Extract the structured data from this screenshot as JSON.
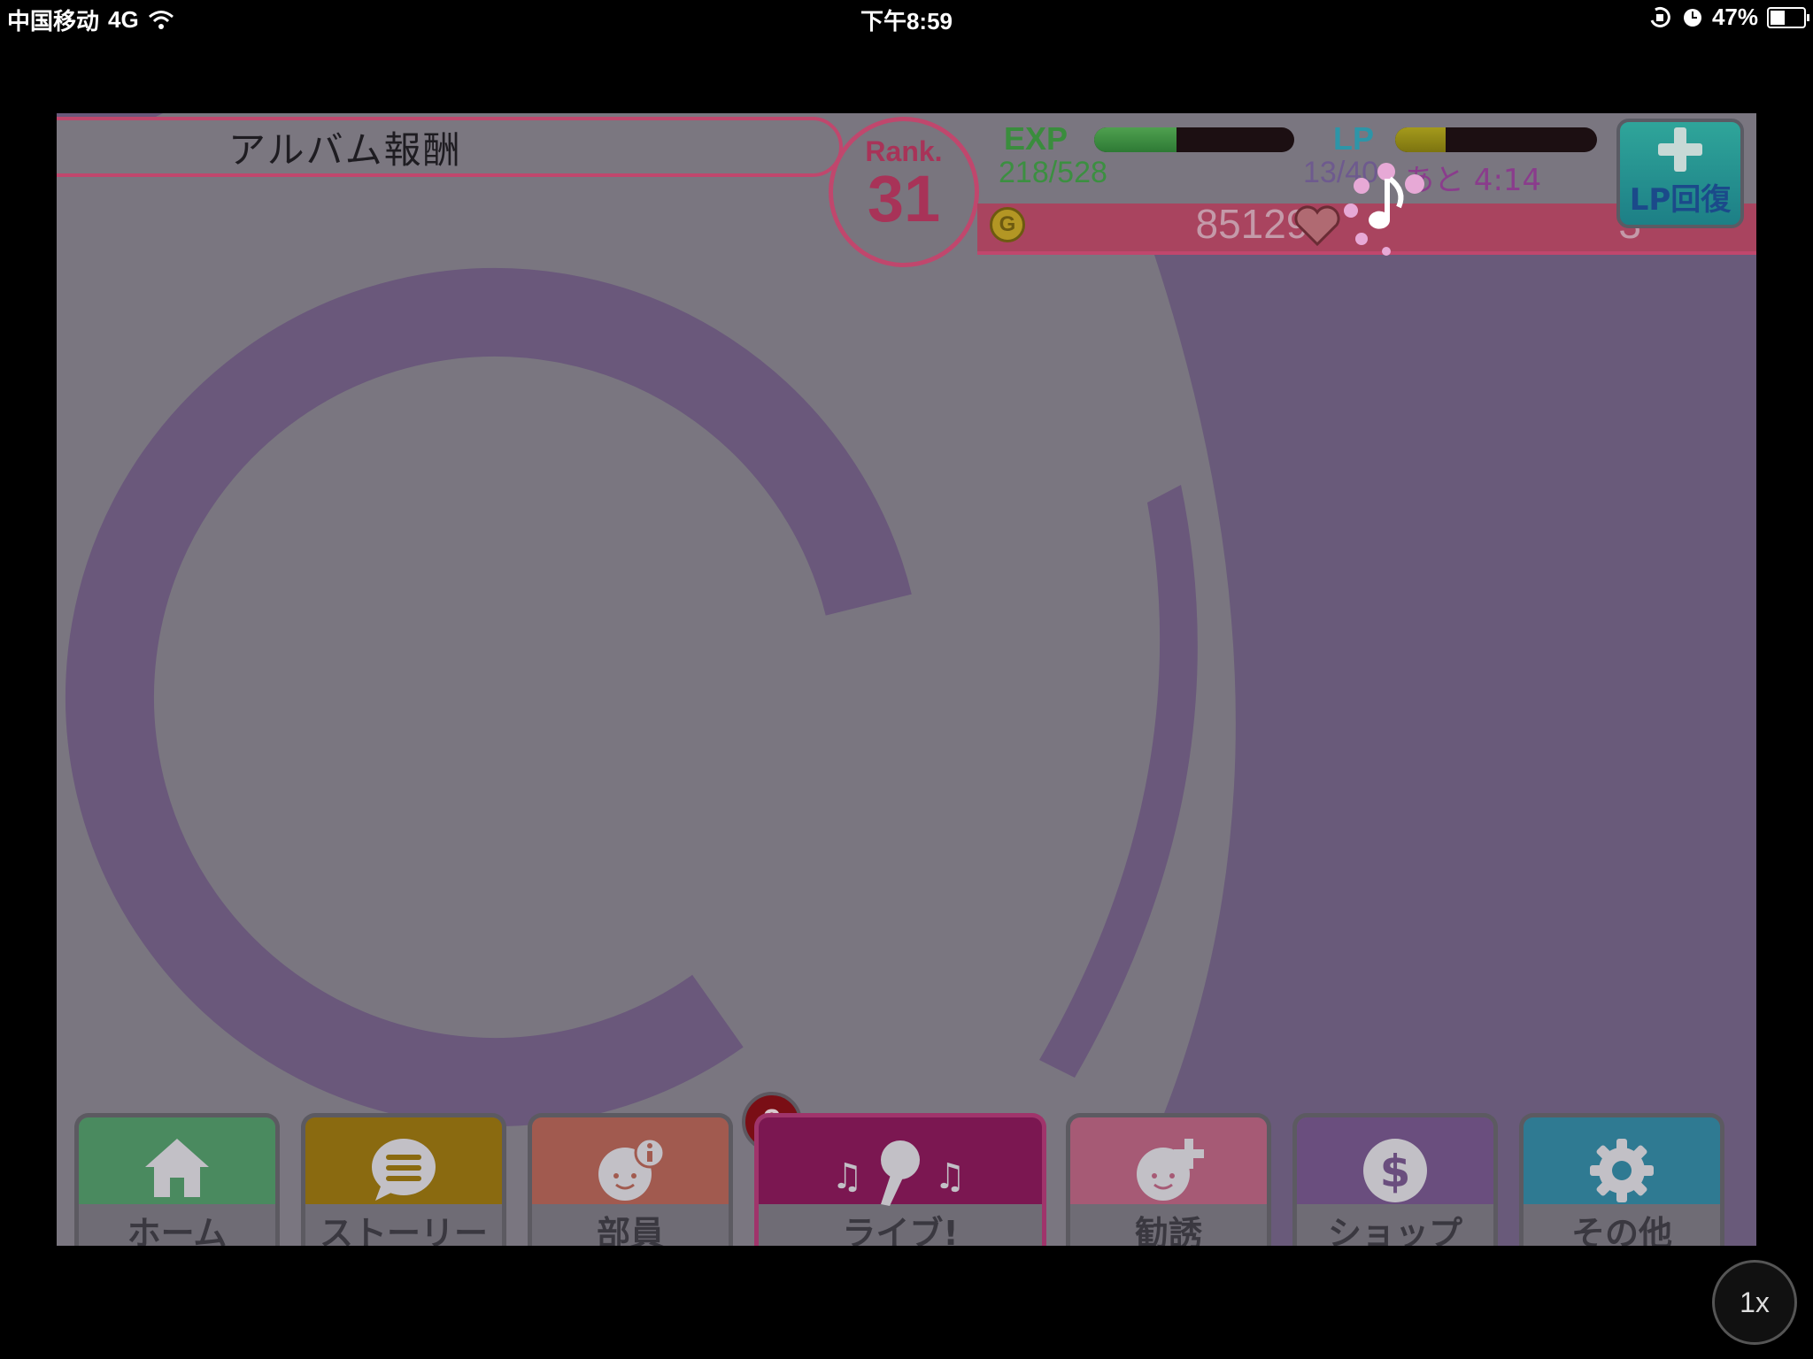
{
  "status_bar": {
    "carrier": "中国移动",
    "network": "4G",
    "time": "下午8:59",
    "battery": "47%",
    "battery_level": 0.47
  },
  "header": {
    "title": "アルバム報酬",
    "rank_label": "Rank.",
    "rank_value": "31",
    "exp_label": "EXP",
    "exp_value": "218/528",
    "exp_progress": 0.41,
    "lp_label": "LP",
    "lp_value": "13/40",
    "lp_timer": "あと 4:14",
    "lp_progress": 0.25,
    "money": "851290",
    "loveca": "3",
    "lp_recover_label": "LP回復"
  },
  "nav": {
    "home": "ホーム",
    "story": "ストーリー",
    "members": "部員",
    "members_badge": "3",
    "live": "ライブ!",
    "scout": "勧誘",
    "shop": "ショップ",
    "other": "その他"
  },
  "speed_button": "1x",
  "colors": {
    "accent_pink": "#c0476d",
    "bg_purple": "#695a7a",
    "nav_home": "#4a8a5f",
    "nav_story": "#8a6a10",
    "nav_members": "#a15a4f",
    "nav_live": "#7b1751",
    "nav_scout": "#a65a75",
    "nav_shop": "#6a4e7e",
    "nav_other": "#2f7a92"
  },
  "icons": [
    "signal-icon",
    "wifi-icon",
    "rotation-lock-icon",
    "alarm-icon",
    "battery-icon",
    "coin-icon",
    "heart-icon",
    "music-note-icon",
    "plus-icon",
    "home-icon",
    "chat-icon",
    "member-icon",
    "microphone-icon",
    "add-member-icon",
    "dollar-icon",
    "gear-icon"
  ]
}
